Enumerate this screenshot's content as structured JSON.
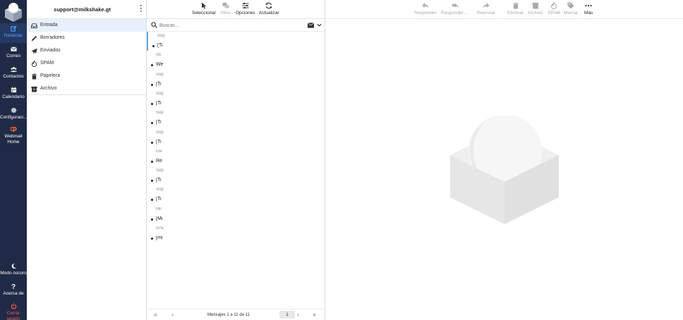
{
  "nav": {
    "compose": "Redactar",
    "mail": "Correo",
    "contacts": "Contactos",
    "calendar": "Calendario",
    "settings": "Configuraci...",
    "webmail_home": "Webmail Home",
    "dark_mode": "Modo oscuro",
    "about": "Acerca de",
    "logout": "Cerrar sesión"
  },
  "account": "support@milkshake.gt",
  "folders": [
    {
      "label": "Entrada",
      "icon": "inbox-icon",
      "active": true
    },
    {
      "label": "Borradores",
      "icon": "pencil-icon"
    },
    {
      "label": "Enviados",
      "icon": "send-icon"
    },
    {
      "label": "SPAM",
      "icon": "fire-icon"
    },
    {
      "label": "Papelera",
      "icon": "trash-icon"
    },
    {
      "label": "Archivo",
      "icon": "archive-icon"
    }
  ],
  "list_toolbar": {
    "select": "Seleccionar",
    "threads": "Hilos",
    "options": "Opciones",
    "refresh": "Actualizar"
  },
  "search": {
    "placeholder": "Buscar..."
  },
  "messages": [
    {
      "from": "Sop",
      "subject": "[Ti"
    },
    {
      "from": "Sti",
      "subject": "We"
    },
    {
      "from": "Sop",
      "subject": "[Ti"
    },
    {
      "from": "Sop",
      "subject": "[Ti"
    },
    {
      "from": "Sop",
      "subject": "[Ti"
    },
    {
      "from": "Sop",
      "subject": "[Ti"
    },
    {
      "from": "Ele",
      "subject": "Re"
    },
    {
      "from": "Sop",
      "subject": "[Ti"
    },
    {
      "from": "Sop",
      "subject": "[Ti"
    },
    {
      "from": "Mil",
      "subject": "[Mi"
    },
    {
      "from": "cPa",
      "subject": "[mi"
    }
  ],
  "pager": {
    "first": "«",
    "prev": "‹",
    "next": "›",
    "last": "»",
    "count": "Mensajes 1 a 11 de 11",
    "page": "1"
  },
  "preview_toolbar": {
    "reply": "Responder",
    "reply_all": "Responder ...",
    "forward": "Reenviar",
    "delete": "Eliminar",
    "archive": "Archivo",
    "spam": "SPAM",
    "mark": "Marcar",
    "more": "Más"
  },
  "colors": {
    "sidebar": "#1f2b46",
    "accent": "#57a5ff",
    "logout": "#ff5a5a",
    "selected_folder": "#e8f1fb"
  }
}
